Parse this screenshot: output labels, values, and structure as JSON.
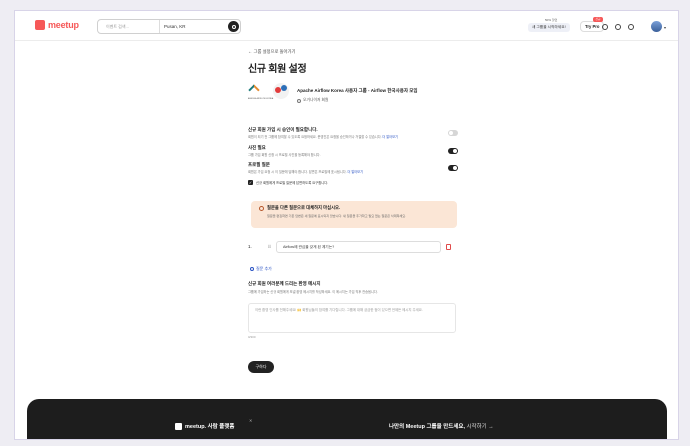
{
  "brand": {
    "name": "meetup",
    "color": "#f65858"
  },
  "search": {
    "keyword_placeholder": "이벤트 검색...",
    "location": "Pusan, KR"
  },
  "header": {
    "start_group_label": "새 그룹을 시작하세요!",
    "discount_label": "50% 할인",
    "try_pro_label": "Try Pro",
    "new_badge": "신규"
  },
  "page": {
    "back_label": "← 그룹 설정으로 돌아가기",
    "title": "신규 회원 설정",
    "group_name": "Apache Airflow Korea 사용자 그룹 - Airflow 한국사용자 모임",
    "group_sub": "오거나이저 회원",
    "thumb_caption": "APACHE AIRFLOW KOREA"
  },
  "settings": {
    "approval": {
      "title": "신규 회원 가입 시 승인이 필요합니다.",
      "desc": "회원이 되기 전 그룹에 참여할 수 있도록 요청하세요. 운영진은 요청을 승인하거나 거절할 수 있습니다.",
      "link": "더 알아보기",
      "on": false
    },
    "photo": {
      "title": "사진 필요",
      "desc": "그룹 가입 회원 신청 시 프로필 사진을 등록해야 합니다.",
      "on": true
    },
    "profile_q": {
      "title": "프로필 질문",
      "desc": "회원은 가입 요청 시 이 질문에 답해야 합니다. 답변은 프로필에 표시됩니다.",
      "link": "더 알아보기",
      "on": true
    },
    "checkbox_label": "신규 회원에게 프로필 질문에 답변하도록 요구합니다."
  },
  "alert": {
    "title": "질문을 다른 질문으로 대체하지 마십시오.",
    "body": "질문을 편집하면 기존 답변은 새 질문에 표시되지 않습니다. 새 질문을 추가하고 필요 없는 질문은 삭제하세요."
  },
  "question": {
    "number": "1.",
    "text": "Airflow에 관심을 갖게 된 계기는?",
    "add_label": "질문 추가"
  },
  "welcome": {
    "title": "신규 회원 여러분께 드리는 환영 메시지",
    "desc": "그룹에 가입하는 신규 회원에게 보낼 환영 메시지를 작성하세요. 이 메시지는 가입 직후 전송됩니다.",
    "placeholder": "이런 환영 인사를 전해주세요! 🙌 회원님들의 참여를 기다립니다. 그룹에 대해 궁금한 점이 있으면 언제든 메시지 주세요.",
    "count": "0/300"
  },
  "save_label": "구하다",
  "footer": {
    "tag": "meetup. 사람 플랫폼",
    "cta": "나만의 Meetup 그룹을 만드세요",
    "cta_link": "시작하기 →"
  }
}
